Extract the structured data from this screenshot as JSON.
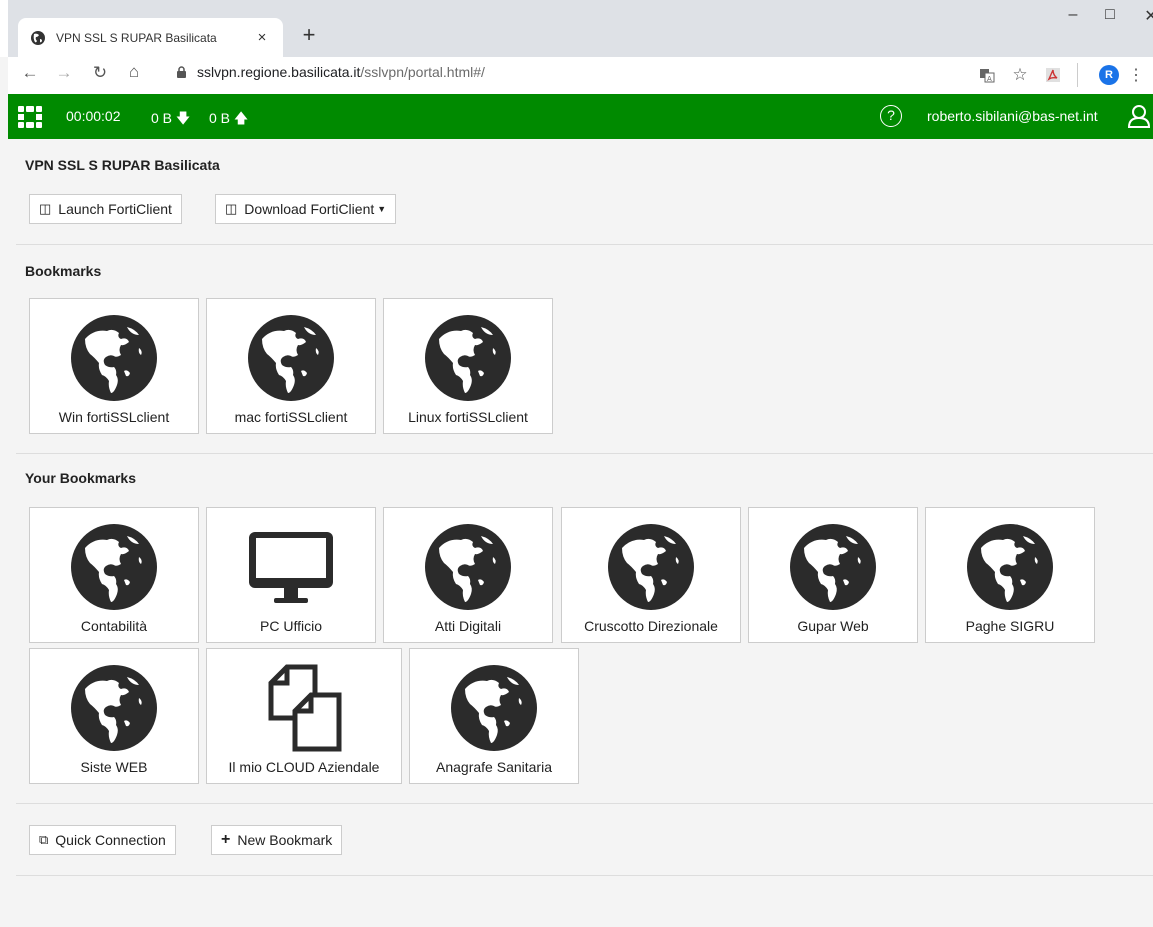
{
  "browser": {
    "tab_title": "VPN SSL S RUPAR Basilicata",
    "tab_close": "×",
    "new_tab": "+",
    "url_host": "sslvpn.regione.basilicata.it",
    "url_path": "/sslvpn/portal.html#/",
    "profile_initial": "R"
  },
  "header": {
    "timer": "00:00:02",
    "download": "0 B",
    "upload": "0 B",
    "help": "?",
    "user": "roberto.sibilani@bas-net.int",
    "accent": "#008a00"
  },
  "page": {
    "title": "VPN SSL S RUPAR Basilicata",
    "launch_label": "Launch FortiClient",
    "download_label": "Download FortiClient",
    "bookmarks_heading": "Bookmarks",
    "your_bookmarks_heading": "Your Bookmarks",
    "quick_connection_label": "Quick Connection",
    "new_bookmark_label": "New Bookmark"
  },
  "bookmarks": [
    {
      "label": "Win fortiSSLclient",
      "icon": "globe-icon"
    },
    {
      "label": "mac fortiSSLclient",
      "icon": "globe-icon"
    },
    {
      "label": "Linux fortiSSLclient",
      "icon": "globe-icon"
    }
  ],
  "your_bookmarks": [
    {
      "label": "Contabilità",
      "icon": "globe-icon"
    },
    {
      "label": "PC Ufficio",
      "icon": "monitor-icon"
    },
    {
      "label": "Atti Digitali",
      "icon": "globe-icon"
    },
    {
      "label": "Cruscotto Direzionale",
      "icon": "globe-icon"
    },
    {
      "label": "Gupar Web",
      "icon": "globe-icon"
    },
    {
      "label": "Paghe SIGRU",
      "icon": "globe-icon"
    },
    {
      "label": "Siste WEB",
      "icon": "globe-icon"
    },
    {
      "label": "Il mio CLOUD Aziendale",
      "icon": "files-icon"
    },
    {
      "label": "Anagrafe Sanitaria",
      "icon": "globe-icon"
    }
  ]
}
